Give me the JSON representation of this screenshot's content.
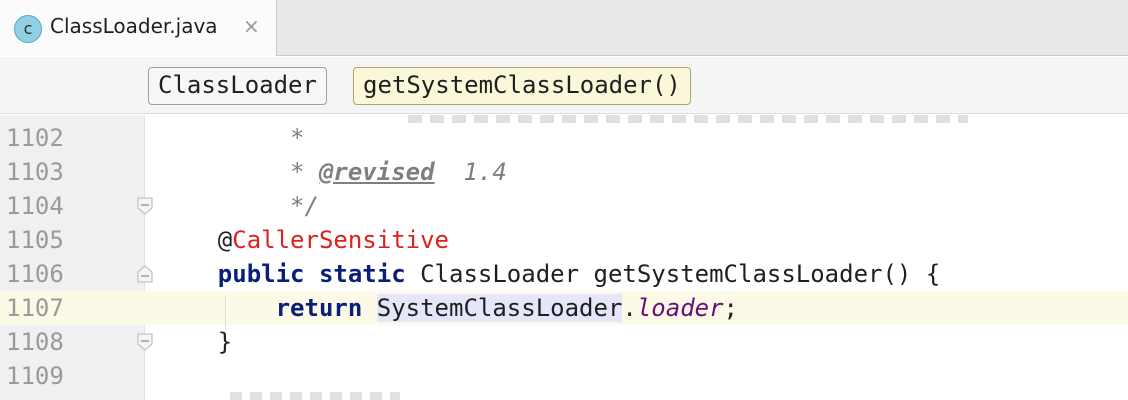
{
  "tab": {
    "icon": "class-c-icon",
    "icon_letter": "c",
    "title": "ClassLoader.java",
    "close": "×"
  },
  "breadcrumbs": [
    "ClassLoader",
    "getSystemClassLoader()"
  ],
  "editor": {
    "lines": [
      {
        "number": "1102",
        "star": "*"
      },
      {
        "number": "1103",
        "star": "* ",
        "tag": "@revised",
        "value": "  1.4"
      },
      {
        "number": "1104",
        "close": "*/"
      },
      {
        "number": "1105",
        "at": "@",
        "annotation": "CallerSensitive"
      },
      {
        "number": "1106",
        "kw1": "public",
        "kw2": "static",
        "rest": " ClassLoader getSystemClassLoader() {"
      },
      {
        "number": "1107",
        "kw": "return",
        "cls": "SystemClassLoader",
        "dot": ".",
        "field": "loader",
        "end": ";"
      },
      {
        "number": "1108",
        "brace": "}"
      },
      {
        "number": "1109"
      }
    ]
  },
  "colors": {
    "keyword": "#0a1f78",
    "annotation": "#d8231f",
    "field": "#660e7a",
    "current_line": "#fcf9e7"
  }
}
